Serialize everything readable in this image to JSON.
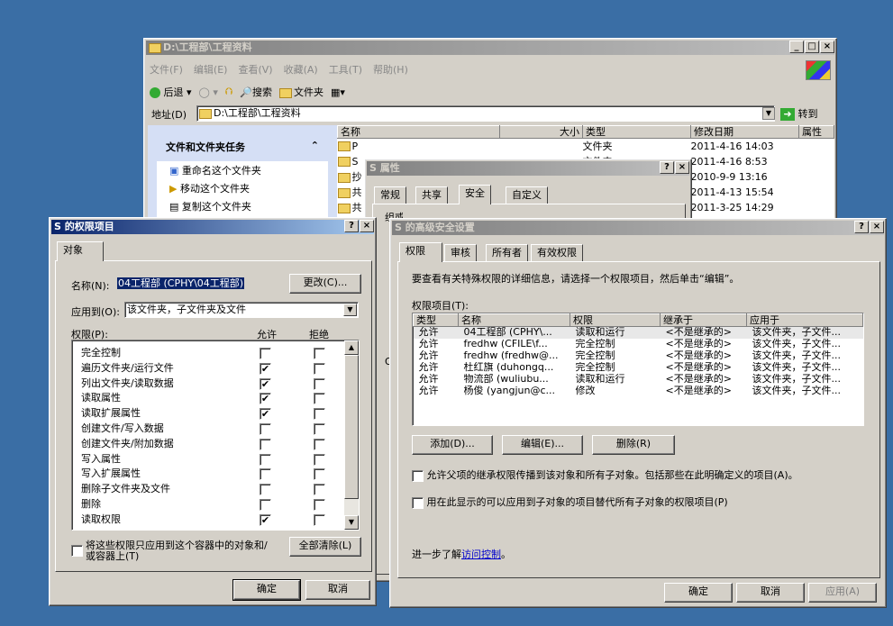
{
  "explorer": {
    "title": "D:\\工程部\\工程资料",
    "menu": [
      "文件(F)",
      "编辑(E)",
      "查看(V)",
      "收藏(A)",
      "工具(T)",
      "帮助(H)"
    ],
    "back": "后退",
    "search": "搜索",
    "folders": "文件夹",
    "address_label": "地址(D)",
    "address": "D:\\工程部\\工程资料",
    "go": "转到",
    "tasks_title": "文件和文件夹任务",
    "tasks": [
      "重命名这个文件夹",
      "移动这个文件夹",
      "复制这个文件夹"
    ],
    "cols": [
      "名称",
      "大小",
      "类型",
      "修改日期",
      "属性"
    ],
    "rows": [
      {
        "name": "P",
        "type": "文件夹",
        "date": "2011-4-16 14:03"
      },
      {
        "name": "S",
        "type": "文件夹",
        "date": "2011-4-16 8:53"
      },
      {
        "name": "抄",
        "type": "",
        "date": "2010-9-9 13:16"
      },
      {
        "name": "共",
        "type": "",
        "date": "2011-4-13 15:54"
      },
      {
        "name": "共",
        "type": "",
        "date": "2011-3-25 14:29"
      }
    ]
  },
  "props": {
    "title": "S 属性",
    "tabs": [
      "常规",
      "共享",
      "安全",
      "自定义"
    ],
    "group_label": "组或用户名称(G):",
    "partial": "O"
  },
  "perm": {
    "title": "S 的权限项目",
    "tab": "对象",
    "name_label": "名称(N):",
    "name_value": "04工程部 (CPHY\\04工程部)",
    "change": "更改(C)...",
    "apply_label": "应用到(O):",
    "apply_value": "该文件夹，子文件夹及文件",
    "perm_label": "权限(P):",
    "allow": "允许",
    "deny": "拒绝",
    "items": [
      {
        "n": "完全控制",
        "a": false,
        "d": false
      },
      {
        "n": "遍历文件夹/运行文件",
        "a": true,
        "d": false
      },
      {
        "n": "列出文件夹/读取数据",
        "a": true,
        "d": false
      },
      {
        "n": "读取属性",
        "a": true,
        "d": false
      },
      {
        "n": "读取扩展属性",
        "a": true,
        "d": false
      },
      {
        "n": "创建文件/写入数据",
        "a": false,
        "d": false
      },
      {
        "n": "创建文件夹/附加数据",
        "a": false,
        "d": false
      },
      {
        "n": "写入属性",
        "a": false,
        "d": false
      },
      {
        "n": "写入扩展属性",
        "a": false,
        "d": false
      },
      {
        "n": "删除子文件夹及文件",
        "a": false,
        "d": false
      },
      {
        "n": "删除",
        "a": false,
        "d": false
      },
      {
        "n": "读取权限",
        "a": true,
        "d": false
      }
    ],
    "only_this": "将这些权限只应用到这个容器中的对象和/或容器上(T)",
    "clear_all": "全部清除(L)",
    "ok": "确定",
    "cancel": "取消"
  },
  "adv": {
    "title": "S 的高级安全设置",
    "tabs": [
      "权限",
      "审核",
      "所有者",
      "有效权限"
    ],
    "desc": "要查看有关特殊权限的详细信息，请选择一个权限项目，然后单击“编辑”。",
    "list_label": "权限项目(T):",
    "cols": [
      "类型",
      "名称",
      "权限",
      "继承于",
      "应用于"
    ],
    "rows": [
      {
        "t": "允许",
        "n": "04工程部 (CPHY\\...",
        "p": "读取和运行",
        "i": "<不是继承的>",
        "a": "该文件夹，子文件..."
      },
      {
        "t": "允许",
        "n": "fredhw (CFILE\\f...",
        "p": "完全控制",
        "i": "<不是继承的>",
        "a": "该文件夹，子文件..."
      },
      {
        "t": "允许",
        "n": "fredhw (fredhw@...",
        "p": "完全控制",
        "i": "<不是继承的>",
        "a": "该文件夹，子文件..."
      },
      {
        "t": "允许",
        "n": "杜红旗 (duhongq...",
        "p": "完全控制",
        "i": "<不是继承的>",
        "a": "该文件夹，子文件..."
      },
      {
        "t": "允许",
        "n": "物流部 (wuliubu...",
        "p": "读取和运行",
        "i": "<不是继承的>",
        "a": "该文件夹，子文件..."
      },
      {
        "t": "允许",
        "n": "杨俊 (yangjun@c...",
        "p": "修改",
        "i": "<不是继承的>",
        "a": "该文件夹，子文件..."
      }
    ],
    "add": "添加(D)...",
    "edit": "编辑(E)...",
    "remove": "删除(R)",
    "inherit": "允许父项的继承权限传播到该对象和所有子对象。包括那些在此明确定义的项目(A)。",
    "replace": "用在此显示的可以应用到子对象的项目替代所有子对象的权限项目(P)",
    "learn_prefix": "进一步了解",
    "learn_link": "访问控制",
    "learn_suffix": "。",
    "ok": "确定",
    "cancel": "取消",
    "apply": "应用(A)"
  }
}
